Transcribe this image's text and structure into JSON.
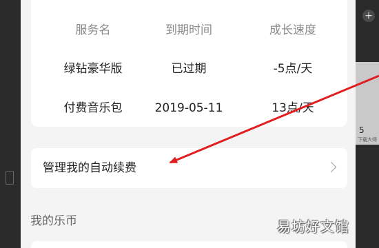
{
  "service_table": {
    "headers": [
      "服务名",
      "到期时间",
      "成长速度"
    ],
    "rows": [
      [
        "绿钻豪华版",
        "已过期",
        "-5点/天"
      ],
      [
        "付费音乐包",
        "2019-05-11",
        "13点/天"
      ]
    ]
  },
  "auto_renew": {
    "label": "管理我的自动续费",
    "icon": "chevron-right-icon"
  },
  "section": {
    "title": "我的乐币"
  },
  "watermark": "易坊好文馆",
  "background": {
    "right_number": "5",
    "right_caption": "下载大师"
  },
  "annotation_color": "#e02020"
}
